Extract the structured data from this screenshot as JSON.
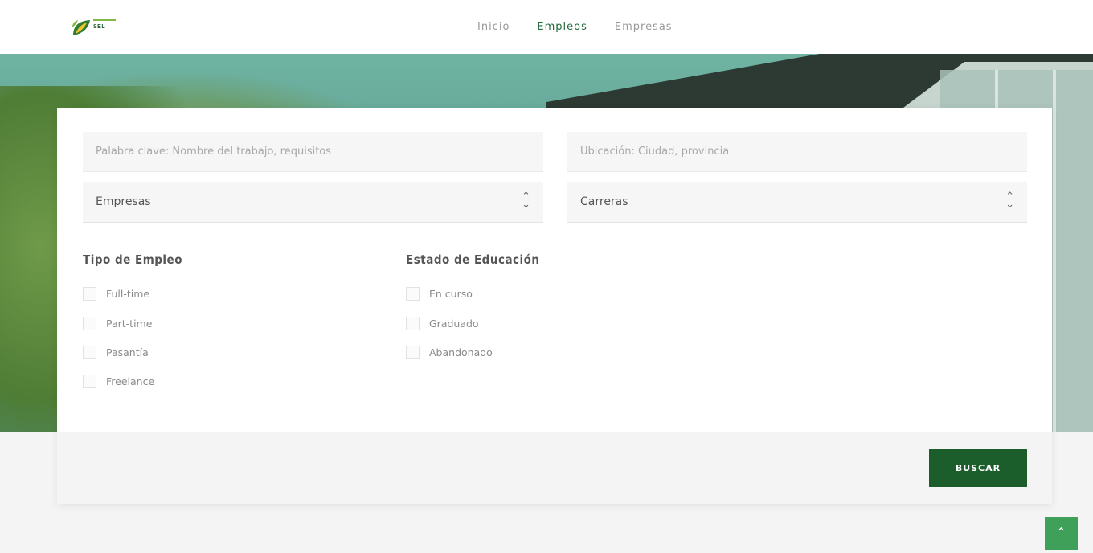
{
  "brand": {
    "logo_text": "SEL"
  },
  "nav": {
    "items": [
      {
        "label": "Inicio",
        "active": false
      },
      {
        "label": "Empleos",
        "active": true
      },
      {
        "label": "Empresas",
        "active": false
      }
    ]
  },
  "search": {
    "keyword_placeholder": "Palabra clave: Nombre del trabajo, requisitos",
    "location_placeholder": "Ubicación: Ciudad, provincia",
    "company_select": "Empresas",
    "career_select": "Carreras"
  },
  "filters": {
    "employment": {
      "title": "Tipo de Empleo",
      "options": [
        "Full-time",
        "Part-time",
        "Pasantía",
        "Freelance"
      ]
    },
    "education": {
      "title": "Estado de Educación",
      "options": [
        "En curso",
        "Graduado",
        "Abandonado"
      ]
    }
  },
  "actions": {
    "search_label": "BUSCAR",
    "top_icon": "chevron-up-icon"
  },
  "colors": {
    "brand_green": "#1b5e2b",
    "accent_green": "#3fa05a"
  }
}
